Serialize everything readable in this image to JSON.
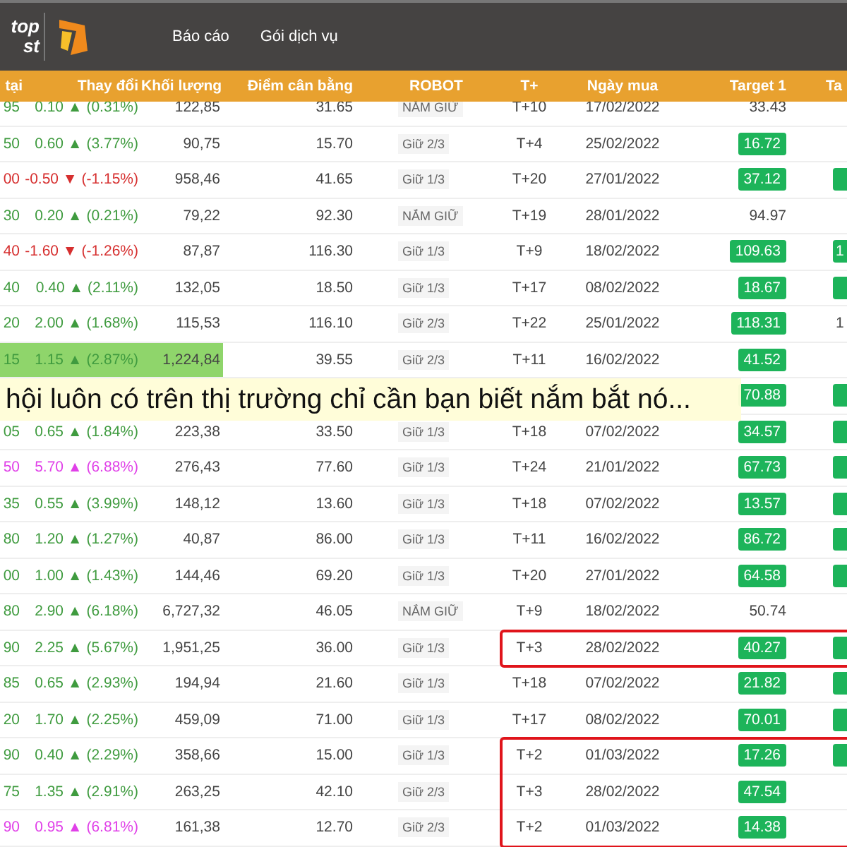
{
  "navbar": {
    "logo_lines": [
      "top",
      "st"
    ],
    "menu": [
      "Báo cáo",
      "Gói dịch vụ"
    ]
  },
  "table": {
    "columns": [
      "tại",
      "Thay đổi",
      "Khối lượng",
      "Điểm cân bằng",
      "ROBOT",
      "T+",
      "Ngày mua",
      "Target 1",
      "Ta"
    ],
    "rows": [
      {
        "price": "95",
        "color": "#3f9b3f",
        "change": "0.10 ▲ (0.31%)",
        "volume": "122,85",
        "balance": "31.65",
        "robot": "NẮM GIỮ",
        "t": "T+10",
        "date": "17/02/2022",
        "target_1": {
          "text": "33.43",
          "badge": false
        }
      },
      {
        "price": "50",
        "color": "#3f9b3f",
        "change": "0.60 ▲ (3.77%)",
        "volume": "90,75",
        "balance": "15.70",
        "robot": "Giữ 2/3",
        "t": "T+4",
        "date": "25/02/2022",
        "target_1": {
          "text": "16.72",
          "badge": true
        }
      },
      {
        "price": "00",
        "color": "#d62f2f",
        "change": "-0.50 ▼ (-1.15%)",
        "volume": "958,46",
        "balance": "41.65",
        "robot": "Giữ 1/3",
        "t": "T+20",
        "date": "27/01/2022",
        "target_1": {
          "text": "37.12",
          "badge": true
        },
        "target_2": {
          "badge": true
        }
      },
      {
        "price": "30",
        "color": "#3f9b3f",
        "change": "0.20 ▲ (0.21%)",
        "volume": "79,22",
        "balance": "92.30",
        "robot": "NẮM GIỮ",
        "t": "T+19",
        "date": "28/01/2022",
        "target_1": {
          "text": "94.97",
          "badge": false
        }
      },
      {
        "price": "40",
        "color": "#d62f2f",
        "change": "-1.60 ▼ (-1.26%)",
        "volume": "87,87",
        "balance": "116.30",
        "robot": "Giữ 1/3",
        "t": "T+9",
        "date": "18/02/2022",
        "target_1": {
          "text": "109.63",
          "badge": true
        },
        "target_2": {
          "text": "1",
          "badge": true
        }
      },
      {
        "price": "40",
        "color": "#3f9b3f",
        "change": "0.40 ▲ (2.11%)",
        "volume": "132,05",
        "balance": "18.50",
        "robot": "Giữ 1/3",
        "t": "T+17",
        "date": "08/02/2022",
        "target_1": {
          "text": "18.67",
          "badge": true
        },
        "target_2": {
          "badge": true
        }
      },
      {
        "price": "20",
        "color": "#3f9b3f",
        "change": "2.00 ▲ (1.68%)",
        "volume": "115,53",
        "balance": "116.10",
        "robot": "Giữ 2/3",
        "t": "T+22",
        "date": "25/01/2022",
        "target_1": {
          "text": "118.31",
          "badge": true
        },
        "target_2": {
          "text": "1",
          "badge": false
        }
      },
      {
        "price": "15",
        "color": "#3f9b3f",
        "change": "1.15 ▲ (2.87%)",
        "volume": "1,224,84",
        "highlighted": true,
        "balance": "39.55",
        "robot": "Giữ 2/3",
        "t": "T+11",
        "date": "16/02/2022",
        "target_1": {
          "text": "41.52",
          "badge": true
        }
      },
      {
        "target_1": {
          "text": "70.88",
          "badge": true
        },
        "target_2": {
          "badge": true
        }
      },
      {
        "price": "05",
        "color": "#3f9b3f",
        "change": "0.65 ▲ (1.84%)",
        "volume": "223,38",
        "balance": "33.50",
        "robot": "Giữ 1/3",
        "t": "T+18",
        "date": "07/02/2022",
        "target_1": {
          "text": "34.57",
          "badge": true
        },
        "target_2": {
          "badge": true
        }
      },
      {
        "price": "50",
        "color": "#e040e8",
        "change": "5.70 ▲ (6.88%)",
        "volume": "276,43",
        "balance": "77.60",
        "robot": "Giữ 1/3",
        "t": "T+24",
        "date": "21/01/2022",
        "target_1": {
          "text": "67.73",
          "badge": true
        },
        "target_2": {
          "badge": true
        }
      },
      {
        "price": "35",
        "color": "#3f9b3f",
        "change": "0.55 ▲ (3.99%)",
        "volume": "148,12",
        "balance": "13.60",
        "robot": "Giữ 1/3",
        "t": "T+18",
        "date": "07/02/2022",
        "target_1": {
          "text": "13.57",
          "badge": true
        },
        "target_2": {
          "badge": true
        }
      },
      {
        "price": "80",
        "color": "#3f9b3f",
        "change": "1.20 ▲ (1.27%)",
        "volume": "40,87",
        "balance": "86.00",
        "robot": "Giữ 1/3",
        "t": "T+11",
        "date": "16/02/2022",
        "target_1": {
          "text": "86.72",
          "badge": true
        },
        "target_2": {
          "badge": true
        }
      },
      {
        "price": "00",
        "color": "#3f9b3f",
        "change": "1.00 ▲ (1.43%)",
        "volume": "144,46",
        "balance": "69.20",
        "robot": "Giữ 1/3",
        "t": "T+20",
        "date": "27/01/2022",
        "target_1": {
          "text": "64.58",
          "badge": true
        },
        "target_2": {
          "badge": true
        }
      },
      {
        "price": "80",
        "color": "#3f9b3f",
        "change": "2.90 ▲ (6.18%)",
        "volume": "6,727,32",
        "balance": "46.05",
        "robot": "NẮM GIỮ",
        "t": "T+9",
        "date": "18/02/2022",
        "target_1": {
          "text": "50.74",
          "badge": false
        }
      },
      {
        "price": "90",
        "color": "#3f9b3f",
        "change": "2.25 ▲ (5.67%)",
        "volume": "1,951,25",
        "balance": "36.00",
        "robot": "Giữ 1/3",
        "t": "T+3",
        "date": "28/02/2022",
        "outlined": true,
        "target_1": {
          "text": "40.27",
          "badge": true
        },
        "target_2": {
          "badge": true
        }
      },
      {
        "price": "85",
        "color": "#3f9b3f",
        "change": "0.65 ▲ (2.93%)",
        "volume": "194,94",
        "balance": "21.60",
        "robot": "Giữ 1/3",
        "t": "T+18",
        "date": "07/02/2022",
        "target_1": {
          "text": "21.82",
          "badge": true
        },
        "target_2": {
          "badge": true
        }
      },
      {
        "price": "20",
        "color": "#3f9b3f",
        "change": "1.70 ▲ (2.25%)",
        "volume": "459,09",
        "balance": "71.00",
        "robot": "Giữ 1/3",
        "t": "T+17",
        "date": "08/02/2022",
        "target_1": {
          "text": "70.01",
          "badge": true
        },
        "target_2": {
          "badge": true
        }
      },
      {
        "price": "90",
        "color": "#3f9b3f",
        "change": "0.40 ▲ (2.29%)",
        "volume": "358,66",
        "balance": "15.00",
        "robot": "Giữ 1/3",
        "t": "T+2",
        "date": "01/03/2022",
        "outlined": true,
        "target_1": {
          "text": "17.26",
          "badge": true
        },
        "target_2": {
          "badge": true
        }
      },
      {
        "price": "75",
        "color": "#3f9b3f",
        "change": "1.35 ▲ (2.91%)",
        "volume": "263,25",
        "balance": "42.10",
        "robot": "Giữ 2/3",
        "t": "T+3",
        "date": "28/02/2022",
        "outlined": true,
        "target_1": {
          "text": "47.54",
          "badge": true
        }
      },
      {
        "price": "90",
        "color": "#e040e8",
        "change": "0.95 ▲ (6.81%)",
        "volume": "161,38",
        "balance": "12.70",
        "robot": "Giữ 2/3",
        "t": "T+2",
        "date": "01/03/2022",
        "outlined": true,
        "target_1": {
          "text": "14.38",
          "badge": true
        }
      }
    ]
  },
  "subtitle": "hội luôn có trên thị trường chỉ cần bạn biết nắm bắt nó..."
}
